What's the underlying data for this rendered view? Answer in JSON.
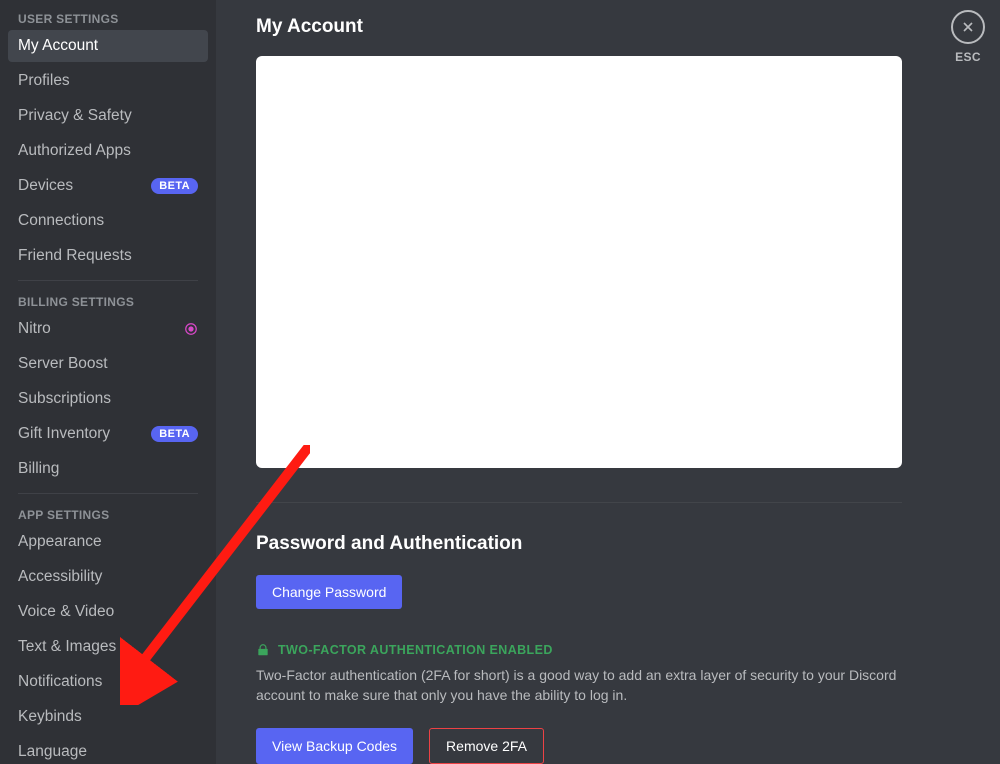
{
  "sidebar": {
    "sections": [
      {
        "header": "USER SETTINGS",
        "items": [
          {
            "label": "My Account",
            "active": true
          },
          {
            "label": "Profiles"
          },
          {
            "label": "Privacy & Safety"
          },
          {
            "label": "Authorized Apps"
          },
          {
            "label": "Devices",
            "badge": "BETA"
          },
          {
            "label": "Connections"
          },
          {
            "label": "Friend Requests"
          }
        ]
      },
      {
        "header": "BILLING SETTINGS",
        "items": [
          {
            "label": "Nitro",
            "icon": "nitro"
          },
          {
            "label": "Server Boost"
          },
          {
            "label": "Subscriptions"
          },
          {
            "label": "Gift Inventory",
            "badge": "BETA"
          },
          {
            "label": "Billing"
          }
        ]
      },
      {
        "header": "APP SETTINGS",
        "items": [
          {
            "label": "Appearance"
          },
          {
            "label": "Accessibility"
          },
          {
            "label": "Voice & Video"
          },
          {
            "label": "Text & Images"
          },
          {
            "label": "Notifications"
          },
          {
            "label": "Keybinds"
          },
          {
            "label": "Language"
          }
        ]
      }
    ]
  },
  "main": {
    "title": "My Account",
    "close_label": "ESC",
    "password_section": {
      "title": "Password and Authentication",
      "change_pw_label": "Change Password",
      "twofa_title": "TWO-FACTOR AUTHENTICATION ENABLED",
      "twofa_desc": "Two-Factor authentication (2FA for short) is a good way to add an extra layer of security to your Discord account to make sure that only you have the ability to log in.",
      "view_codes_label": "View Backup Codes",
      "remove_2fa_label": "Remove 2FA"
    }
  }
}
